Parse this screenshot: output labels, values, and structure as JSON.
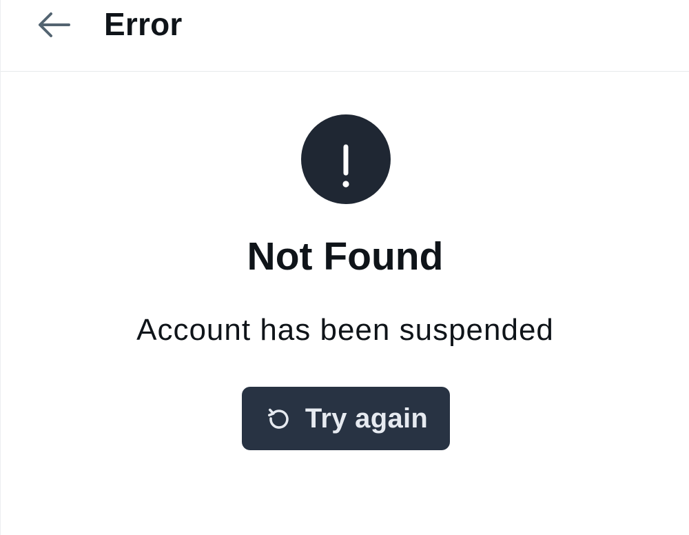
{
  "header": {
    "back_icon": "arrow-left-icon",
    "title": "Error"
  },
  "error": {
    "icon": "exclamation-icon",
    "title": "Not Found",
    "message": "Account has been suspended"
  },
  "retry_button": {
    "icon": "refresh-icon",
    "label": "Try again"
  },
  "colors": {
    "background": "#ffffff",
    "text": "#0f1419",
    "alert_circle": "#1f2733",
    "button_background": "#283343",
    "button_text": "#e6eaf0",
    "back_icon": "#536471",
    "divider": "#e7e9eb"
  }
}
